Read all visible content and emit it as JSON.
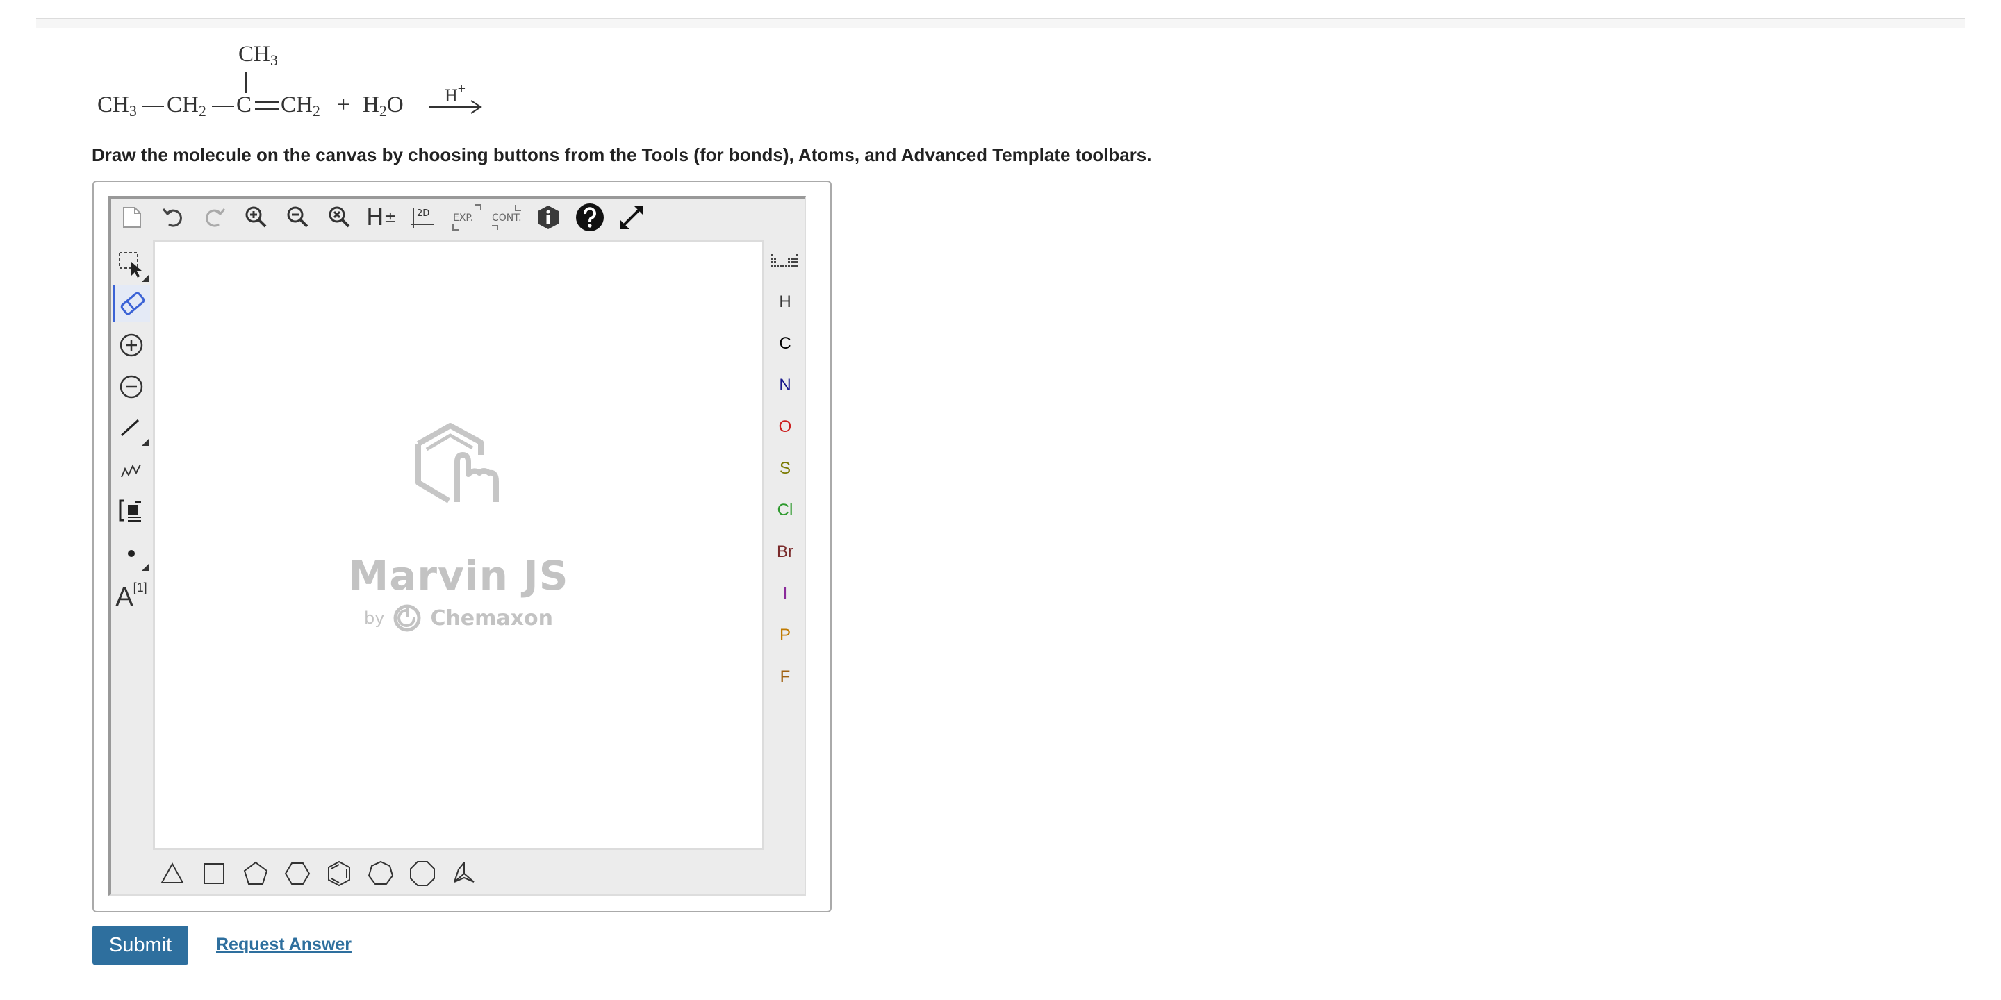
{
  "reaction": {
    "branch_ch": "CH",
    "branch_sub": "3",
    "ch3_main": "CH",
    "ch3_sub": "3",
    "ch2_main": "CH",
    "ch2_sub": "2",
    "c_center": "C",
    "ch2_end": "CH",
    "ch2_end_sub": "2",
    "plus": "+",
    "water_h": "H",
    "water_sub": "2",
    "water_o": "O",
    "catalyst": "H",
    "catalyst_sup": "+"
  },
  "instruction": "Draw the molecule on the canvas by choosing buttons from the Tools (for bonds), Atoms, and Advanced Template toolbars.",
  "toolbar_top": {
    "h_label": "H",
    "h_sign": "±",
    "twod_label": "2D",
    "exp_label": "EXP.",
    "cont_label": "CONT."
  },
  "toolbar_left": {
    "text_tool_label": "A",
    "text_tool_index": "[1]"
  },
  "canvas": {
    "watermark_title": "Marvin JS",
    "watermark_by": "by",
    "watermark_company": "Chemaxon"
  },
  "atoms": [
    {
      "symbol": "H",
      "color": "#333333"
    },
    {
      "symbol": "C",
      "color": "#000000"
    },
    {
      "symbol": "N",
      "color": "#1a1a8c"
    },
    {
      "symbol": "O",
      "color": "#cc1f1f"
    },
    {
      "symbol": "S",
      "color": "#7a7a00"
    },
    {
      "symbol": "Cl",
      "color": "#2f9a2f"
    },
    {
      "symbol": "Br",
      "color": "#7a2a2a"
    },
    {
      "symbol": "I",
      "color": "#8a2a9a"
    },
    {
      "symbol": "P",
      "color": "#c07a00"
    },
    {
      "symbol": "F",
      "color": "#a06010"
    }
  ],
  "actions": {
    "submit_label": "Submit",
    "request_label": "Request Answer"
  },
  "colors": {
    "accent": "#2e6f9e",
    "active_tool": "#3b63d6"
  }
}
